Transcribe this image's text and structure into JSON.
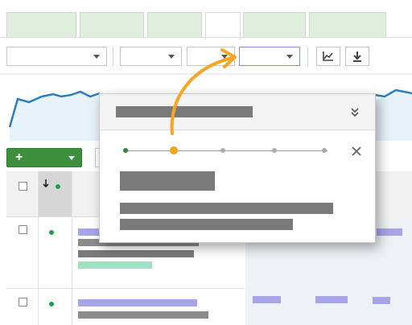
{
  "tabs": [
    {
      "label": "",
      "active": false
    },
    {
      "label": "",
      "active": false
    },
    {
      "label": "",
      "active": false
    },
    {
      "label": "",
      "active": true
    },
    {
      "label": "",
      "active": false
    },
    {
      "label": "",
      "active": false
    }
  ],
  "toolbar": {
    "filters": [
      {
        "value": ""
      },
      {
        "value": ""
      },
      {
        "value": ""
      },
      {
        "value": "",
        "active": true
      }
    ],
    "buttons": [
      {
        "icon": "line-chart-icon"
      },
      {
        "icon": "download-icon"
      }
    ]
  },
  "add_button": {
    "label": "+",
    "icon": "plus-icon"
  },
  "popup": {
    "title": "",
    "steps": 5,
    "current_step": 2,
    "heading": "",
    "body_lines": [
      "",
      ""
    ],
    "collapse_icon": "double-chevron-down-icon",
    "close_icon": "close-icon",
    "arrow_icon": "curved-arrow-icon"
  },
  "colors": {
    "accent_green": "#3d8f3e",
    "active_step_orange": "#f2a41c",
    "highlight_arrow": "#f6a623",
    "chart_line": "#2a7fbf",
    "chart_fill": "#e7f2fa"
  }
}
